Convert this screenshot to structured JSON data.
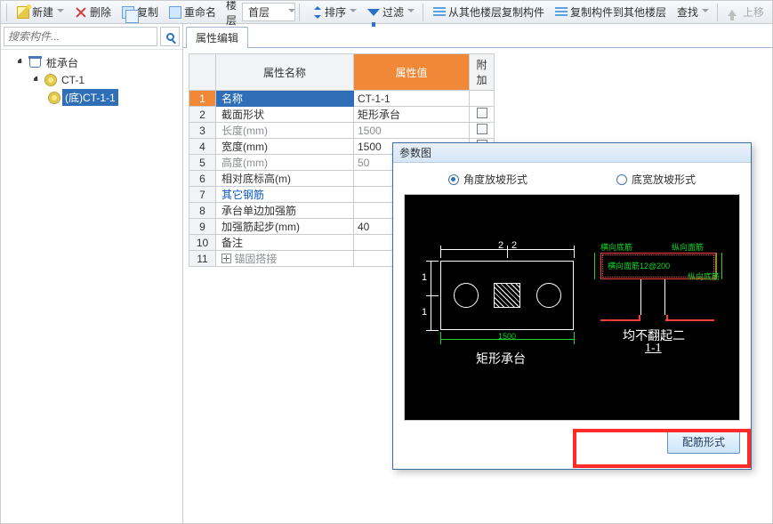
{
  "toolbar": {
    "new": "新建",
    "delete": "删除",
    "copy": "复制",
    "rename": "重命名",
    "layer": "楼层",
    "top_layer": "首层",
    "sort": "排序",
    "filter": "过滤",
    "copy_from": "从其他楼层复制构件",
    "copy_to": "复制构件到其他楼层",
    "find": "查找",
    "move_up": "上移"
  },
  "search": {
    "placeholder": "搜索构件..."
  },
  "tree": {
    "root": "桩承台",
    "child1": "CT-1",
    "child2": "(底)CT-1-1"
  },
  "tab": {
    "props": "属性编辑"
  },
  "grid": {
    "headers": {
      "name": "属性名称",
      "value": "属性值",
      "extra": "附加"
    },
    "rows": [
      {
        "idx": "1",
        "name": "名称",
        "value": "CT-1-1",
        "sel": true,
        "chk": false,
        "gray": false
      },
      {
        "idx": "2",
        "name": "截面形状",
        "value": "矩形承台",
        "chk": true,
        "gray": false
      },
      {
        "idx": "3",
        "name": "长度(mm)",
        "value": "1500",
        "chk": true,
        "gray": true
      },
      {
        "idx": "4",
        "name": "宽度(mm)",
        "value": "1500",
        "chk": true,
        "gray": false
      },
      {
        "idx": "5",
        "name": "高度(mm)",
        "value": "50",
        "chk": true,
        "gray": true
      },
      {
        "idx": "6",
        "name": "相对底标高(m)",
        "value": "",
        "chk": true,
        "gray": false
      },
      {
        "idx": "7",
        "name": "其它钢筋",
        "value": "",
        "chk": false,
        "link": true
      },
      {
        "idx": "8",
        "name": "承台单边加强筋",
        "value": "",
        "chk": true,
        "gray": false
      },
      {
        "idx": "9",
        "name": "加强筋起步(mm)",
        "value": "40",
        "chk": true,
        "gray": false
      },
      {
        "idx": "10",
        "name": "备注",
        "value": "",
        "chk": true,
        "gray": false
      },
      {
        "idx": "11",
        "name": "锚固搭接",
        "value": "",
        "chk": false,
        "plus": true,
        "gray": true
      }
    ]
  },
  "dialog": {
    "title": "参数图",
    "radio1": "角度放坡形式",
    "radio2": "底宽放坡形式",
    "left_caption": "矩形承台",
    "right_caption_top": "均不翻起二",
    "right_caption_bot": "1-1",
    "dim_left_v": "1",
    "dim_left_v2": "1",
    "dim_top_h": "2",
    "dim_top_h2": "2",
    "dim_green": "1500",
    "r_lbl1": "横向底筋",
    "r_lbl2": "纵向面筋",
    "r_lbl3": "横向面筋12@200",
    "r_lbl4": "纵向底筋",
    "button": "配筋形式"
  }
}
